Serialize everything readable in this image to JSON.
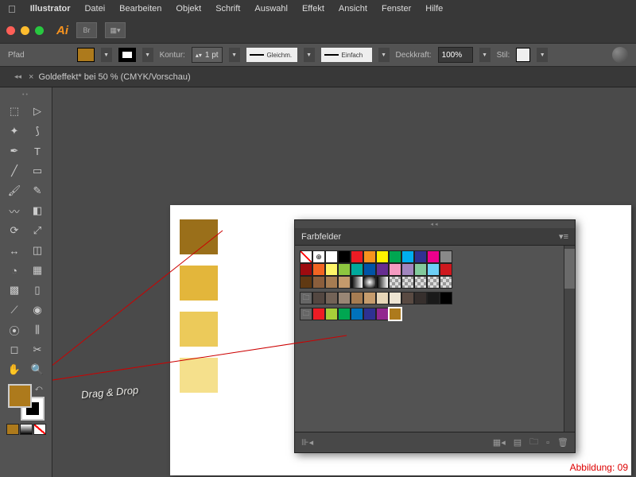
{
  "menubar": {
    "app": "Illustrator",
    "items": [
      "Datei",
      "Bearbeiten",
      "Objekt",
      "Schrift",
      "Auswahl",
      "Effekt",
      "Ansicht",
      "Fenster",
      "Hilfe"
    ]
  },
  "titlebar": {
    "ai": "Ai",
    "br": "Br"
  },
  "control": {
    "object": "Pfad",
    "stroke_label": "Kontur:",
    "stroke_weight": "1 pt",
    "profile": "Gleichm.",
    "brush": "Einfach",
    "opacity_label": "Deckkraft:",
    "opacity": "100%",
    "style_label": "Stil:",
    "fill": "#ad7a1c"
  },
  "tab": {
    "name": "Goldeffekt* bei 50 % (CMYK/Vorschau)"
  },
  "samples": [
    "#9a6f1a",
    "#e3b63b",
    "#ecca5a",
    "#f5e08c"
  ],
  "panel": {
    "title": "Farbfelder",
    "row1": [
      "none",
      "reg",
      "#ffffff",
      "#000000",
      "#ed1c24",
      "#f7931e",
      "#fff200",
      "#00a651",
      "#00aeef",
      "#2e3192",
      "#ec008c",
      "#898989"
    ],
    "row2": [
      "#9e0b0f",
      "#f26522",
      "#fef568",
      "#8dc63f",
      "#00a99d",
      "#0054a6",
      "#662d91",
      "#f49ac1",
      "#a186be",
      "#82ca9c",
      "#6dcff6",
      "#ce181e"
    ],
    "row3": [
      "#603913",
      "#8b5e3c",
      "#a67c52",
      "#c49a6c",
      "grad",
      "rgrad",
      "grad",
      "patt",
      "patt",
      "patt",
      "patt",
      "patt"
    ],
    "row4": [
      "folder",
      "#534741",
      "#736357",
      "#998675",
      "#a67c52",
      "#c69c6d",
      "#e6d6b8",
      "#ede4d1",
      "#594a42",
      "#362f2d",
      "#1a1a1a",
      "#000000"
    ],
    "row5": [
      "folder",
      "#ed1c24",
      "#a6ce39",
      "#00a651",
      "#0072bc",
      "#2e3192",
      "#92278f",
      "#ad7a1c"
    ],
    "selected_index": 7
  },
  "annotation": {
    "text": "Drag & Drop"
  },
  "caption": "Abbildung: 09",
  "fillstroke": {
    "fill": "#ad7a1c"
  }
}
